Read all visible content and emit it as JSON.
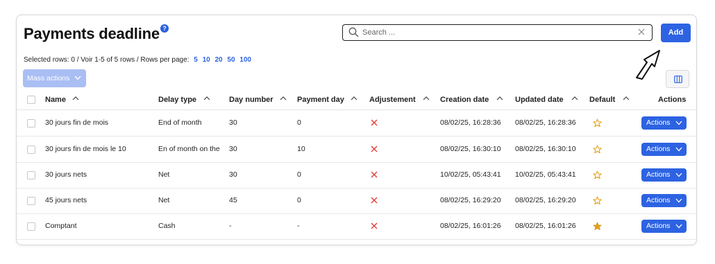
{
  "header": {
    "title": "Payments deadline",
    "help": "?",
    "search_placeholder": "Search ...",
    "add_label": "Add"
  },
  "toolbar": {
    "selection_info": "Selected rows: 0 /  Voir 1-5 of 5 rows /  Rows per page:",
    "rows_per_page_options": [
      "5",
      "10",
      "20",
      "50",
      "100"
    ],
    "mass_actions_label": "Mass actions"
  },
  "table": {
    "columns": [
      "Name",
      "Delay type",
      "Day number",
      "Payment day",
      "Adjustement",
      "Creation date",
      "Updated date",
      "Default",
      "Actions"
    ],
    "rows": [
      {
        "name": "30 jours fin de mois",
        "delay_type": "End of month",
        "day_number": "30",
        "payment_day": "0",
        "adjustment": false,
        "created": "08/02/25, 16:28:36",
        "updated": "08/02/25, 16:28:36",
        "default": false,
        "actions_label": "Actions"
      },
      {
        "name": "30 jours fin de mois le 10",
        "delay_type": "En of month on the",
        "day_number": "30",
        "payment_day": "10",
        "adjustment": false,
        "created": "08/02/25, 16:30:10",
        "updated": "08/02/25, 16:30:10",
        "default": false,
        "actions_label": "Actions"
      },
      {
        "name": "30 jours nets",
        "delay_type": "Net",
        "day_number": "30",
        "payment_day": "0",
        "adjustment": false,
        "created": "10/02/25, 05:43:41",
        "updated": "10/02/25, 05:43:41",
        "default": false,
        "actions_label": "Actions"
      },
      {
        "name": "45 jours nets",
        "delay_type": "Net",
        "day_number": "45",
        "payment_day": "0",
        "adjustment": false,
        "created": "08/02/25, 16:29:20",
        "updated": "08/02/25, 16:29:20",
        "default": false,
        "actions_label": "Actions"
      },
      {
        "name": "Comptant",
        "delay_type": "Cash",
        "day_number": "-",
        "payment_day": "-",
        "adjustment": false,
        "created": "08/02/25, 16:01:26",
        "updated": "08/02/25, 16:01:26",
        "default": true,
        "actions_label": "Actions"
      }
    ]
  },
  "colors": {
    "accent": "#2d63e2",
    "mass_actions_disabled": "#a9bef3",
    "x_mark": "#e0403a",
    "star": "#e3a21a"
  },
  "icons": {
    "search": "search-icon",
    "clear": "close-icon",
    "columns": "columns-icon",
    "sort": "chevron-up-icon",
    "dropdown": "chevron-down-icon",
    "adjustment_no": "x-icon",
    "default_on": "star-filled-icon",
    "default_off": "star-outline-icon",
    "annotation": "arrow-icon"
  }
}
